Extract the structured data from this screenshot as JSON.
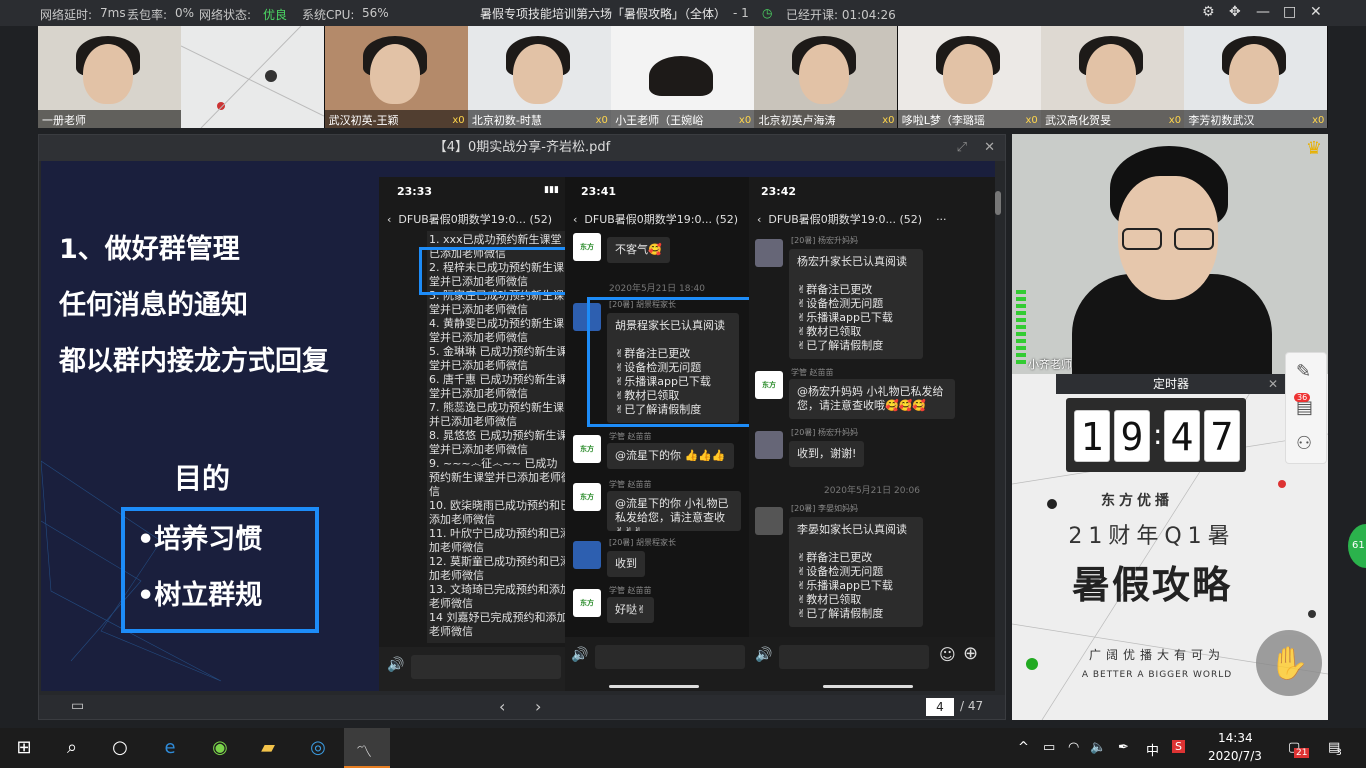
{
  "status": {
    "latency_label": "网络延时:",
    "latency_value": "7ms",
    "loss_label": "丢包率:",
    "loss_value": "0%",
    "net_label": "网络状态:",
    "net_value": "优良",
    "cpu_label": "系统CPU:",
    "cpu_value": "56%",
    "class_title": "暑假专项技能培训第六场「暑假攻略」（全体）",
    "count": "- 1",
    "elapsed": "已经开课: 01:04:26"
  },
  "participants": [
    {
      "name": "一册老师",
      "cups": ""
    },
    {
      "name": "",
      "cups": ""
    },
    {
      "name": "武汉初英-王颖",
      "cups": "x0"
    },
    {
      "name": "北京初数-时慧",
      "cups": "x0"
    },
    {
      "name": "小王老师（王婉峪",
      "cups": "x0"
    },
    {
      "name": "北京初英卢海涛",
      "cups": "x0"
    },
    {
      "name": "哆啦L梦（李璐瑶",
      "cups": "x0"
    },
    {
      "name": "武汉高化贺旻",
      "cups": "x0"
    },
    {
      "name": "李芳初数武汉",
      "cups": "x0"
    }
  ],
  "pdf": {
    "title": "【4】0期实战分享-齐岩松.pdf",
    "page_current": "4",
    "page_total": "/ 47"
  },
  "slide": {
    "heading1": "1、做好群管理",
    "heading2": "任何消息的通知",
    "heading3": "都以群内接龙方式回复",
    "purpose": "目的",
    "bullet1": "•培养习惯",
    "bullet2": "•树立群规"
  },
  "phone1": {
    "time": "23:33",
    "header": "DFUB暑假0期数学19:0... (52)",
    "lines": [
      "1. xxx已成功预约新生课堂",
      "已添加老师微信",
      "2. 程梓未已成功预约新生课",
      "堂并已添加老师微信",
      "3. 阮家庄已成功预约新生课",
      "堂并已添加老师微信",
      "4. 黄静雯已成功预约新生课",
      "堂并已添加老师微信",
      "5. 金琳琳 已成功预约新生课",
      "堂并已添加老师微信",
      "6. 唐千惠 已成功预约新生课",
      "堂并已添加老师微信",
      "7. 熊蕊逸已成功预约新生课",
      "并已添加老师微信",
      "8. 晁悠悠 已成功预约新生课",
      "堂并已添加老师微信",
      "9. ~~~෴征෴~~ 已成功",
      "预约新生课堂并已添加老师微",
      "信",
      "10. 欧柒晓雨已成功预约和已",
      "添加老师微信",
      "11. 叶欣宁已成功预约和已添",
      "加老师微信",
      "12. 莫斯童已成功预约和已添",
      "加老师微信",
      "13. 文琦琦已完成预约和添加",
      "老师微信",
      "14 刘嘉妤已完成预约和添加",
      "老师微信"
    ]
  },
  "phone2": {
    "time": "23:41",
    "header": "DFUB暑假0期数学19:0... (52)",
    "msg1": "不客气🥰",
    "ts1": "2020年5月21日 18:40",
    "sender2": "[20暑] 胡景程家长",
    "msg2_title": "胡景程家长已认真阅读",
    "checklist": [
      "✌群备注已更改",
      "✌设备检测无问题",
      "✌乐播课app已下载",
      "✌教材已领取",
      "✌已了解请假制度"
    ],
    "sender3": "学管 赵苗苗",
    "msg3": "@流星下的你 👍👍👍",
    "sender4": "学管 赵苗苗",
    "msg4": "@流星下的你 小礼物已私发给您，请注意查收✌✌✌",
    "sender5": "[20暑] 胡景程家长",
    "msg5": "收到",
    "sender6": "学管 赵苗苗",
    "msg6": "好哒✌"
  },
  "phone3": {
    "time": "23:42",
    "header": "DFUB暑假0期数学19:0... (52)",
    "sender1": "[20暑] 杨宏升妈妈",
    "msg1_title": "杨宏升家长已认真阅读",
    "checklist": [
      "✌群备注已更改",
      "✌设备检测无问题",
      "✌乐播课app已下载",
      "✌教材已领取",
      "✌已了解请假制度"
    ],
    "sender2": "学管 赵苗苗",
    "msg2": "@杨宏升妈妈 小礼物已私发给您，请注意查收哦🥰🥰🥰",
    "sender3": "[20暑] 杨宏升妈妈",
    "msg3": "收到，谢谢!",
    "ts": "2020年5月21日 20:06",
    "sender4": "[20暑] 李晏如妈妈",
    "msg4_title": "李晏如家长已认真阅读"
  },
  "teacher": {
    "name": "小齐老师"
  },
  "timer": {
    "title": "定时器",
    "d1": "1",
    "d2": "9",
    "d3": "4",
    "d4": "7",
    "brand": "东方优播",
    "line2": "21财年Q1暑",
    "line3": "暑假攻略",
    "tag": "广阔优播大有可为",
    "slogan": "A BETTER   A BIGGER WORLD",
    "badge": "36"
  },
  "taskbar": {
    "time": "14:34",
    "date": "2020/7/3",
    "lang": "中",
    "notif": "21",
    "action_count": "3"
  },
  "colors": {
    "accent_blue": "#1d8cf8",
    "good_green": "#4cd964",
    "slide_bg": "#1a1f3d"
  }
}
